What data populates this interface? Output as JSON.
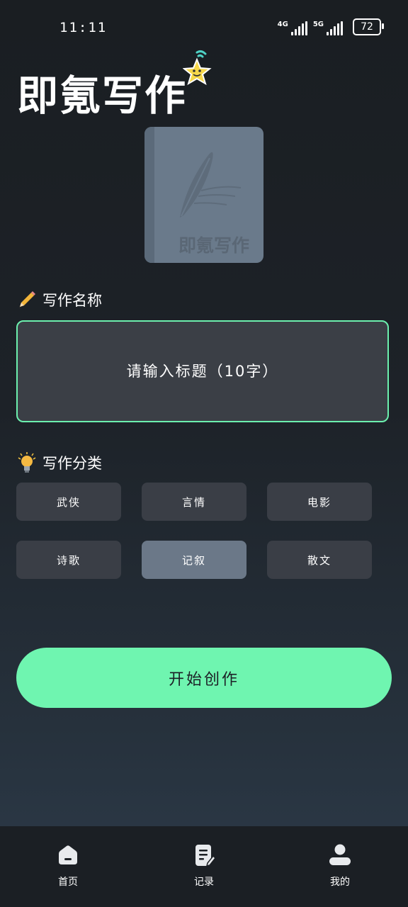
{
  "status_bar": {
    "time": "11:11",
    "network_1": "4G",
    "network_2": "5G",
    "battery": "72"
  },
  "app": {
    "title": "即氪写作",
    "cover_text": "即氪写作"
  },
  "name_section": {
    "title": "写作名称",
    "placeholder": "请输入标题（10字）"
  },
  "category_section": {
    "title": "写作分类",
    "categories": [
      {
        "label": "武侠",
        "selected": false
      },
      {
        "label": "言情",
        "selected": false
      },
      {
        "label": "电影",
        "selected": false
      },
      {
        "label": "诗歌",
        "selected": false
      },
      {
        "label": "记叙",
        "selected": true
      },
      {
        "label": "散文",
        "selected": false
      }
    ]
  },
  "start_button": "开始创作",
  "bottom_nav": [
    {
      "label": "首页",
      "icon": "home-icon"
    },
    {
      "label": "记录",
      "icon": "record-icon"
    },
    {
      "label": "我的",
      "icon": "user-icon"
    }
  ],
  "colors": {
    "accent": "#6ff5b0",
    "input_border": "#6cf0ae",
    "selected_category": "#6b7888",
    "category_bg": "#3a3e46"
  }
}
